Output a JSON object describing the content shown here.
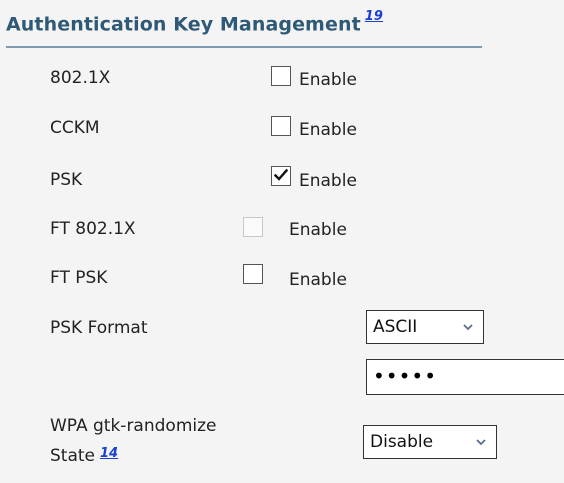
{
  "section": {
    "title": "Authentication Key Management",
    "footnote": "19"
  },
  "rows": [
    {
      "label": "802.1X",
      "enable_label": "Enable",
      "checked": false,
      "disabled": false
    },
    {
      "label": "CCKM",
      "enable_label": "Enable",
      "checked": false,
      "disabled": false
    },
    {
      "label": "PSK",
      "enable_label": "Enable",
      "checked": true,
      "disabled": false
    },
    {
      "label": "FT 802.1X",
      "enable_label": "Enable",
      "checked": false,
      "disabled": true
    },
    {
      "label": "FT PSK",
      "enable_label": "Enable",
      "checked": false,
      "disabled": false
    }
  ],
  "psk_format": {
    "label": "PSK Format",
    "selected": "ASCII",
    "key_masked": "•••••"
  },
  "gtk_randomize": {
    "label_line1": "WPA gtk-randomize",
    "label_line2": "State",
    "footnote": "14",
    "selected": "Disable"
  },
  "colors": {
    "title": "#2e5a78",
    "rule": "#7e9bb2",
    "link": "#1a3fd1",
    "background": "#f4f4f4"
  },
  "icons": {
    "checkmark": "checkmark-icon",
    "dropdown": "chevron-down-icon"
  }
}
